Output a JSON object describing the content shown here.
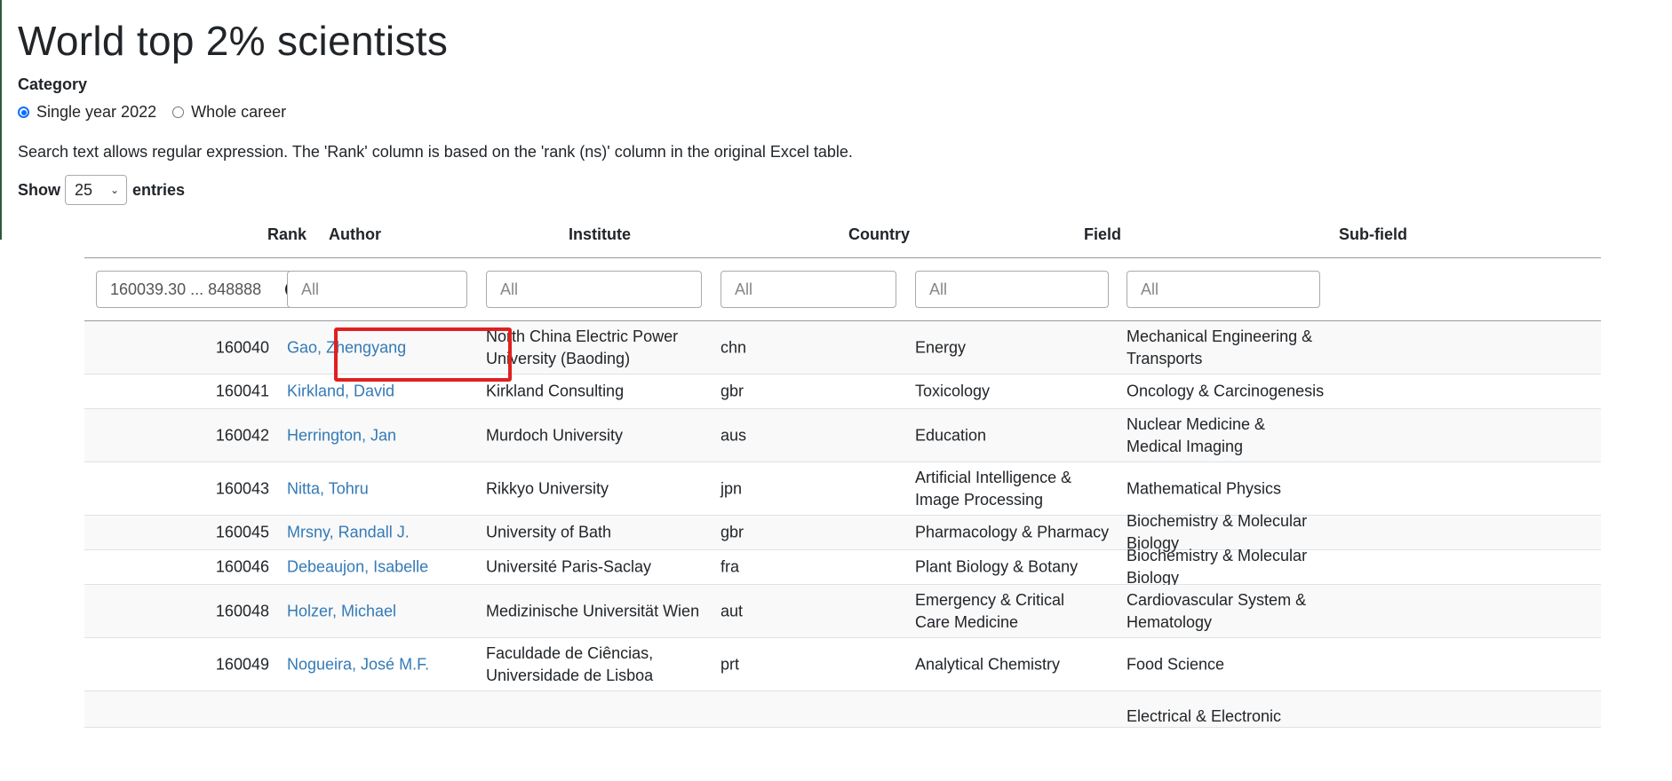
{
  "page": {
    "title": "World top 2% scientists",
    "category_label": "Category",
    "radio_options": [
      {
        "label": "Single year 2022",
        "checked": true
      },
      {
        "label": "Whole career",
        "checked": false
      }
    ],
    "info_text": "Search text allows regular expression. The 'Rank' column is based on the 'rank (ns)' column in the original Excel table.",
    "show_label": "Show",
    "entries_value": "25",
    "entries_label": "entries"
  },
  "table": {
    "headers": {
      "rank": "Rank",
      "author": "Author",
      "institute": "Institute",
      "country": "Country",
      "field": "Field",
      "subfield": "Sub-field"
    },
    "filters": {
      "rank_value": "160039.30 ... 848888",
      "author_placeholder": "All",
      "institute_placeholder": "All",
      "country_placeholder": "All",
      "field_placeholder": "All",
      "subfield_placeholder": "All"
    },
    "rows": [
      {
        "rank": "160040",
        "author": "Gao, Zhengyang",
        "institute": "North China Electric Power University (Baoding)",
        "country": "chn",
        "field": "Energy",
        "subfield": "Mechanical Engineering & Transports"
      },
      {
        "rank": "160041",
        "author": "Kirkland, David",
        "institute": "Kirkland Consulting",
        "country": "gbr",
        "field": "Toxicology",
        "subfield": "Oncology & Carcinogenesis"
      },
      {
        "rank": "160042",
        "author": "Herrington, Jan",
        "institute": "Murdoch University",
        "country": "aus",
        "field": "Education",
        "subfield": "Nuclear Medicine & Medical Imaging"
      },
      {
        "rank": "160043",
        "author": "Nitta, Tohru",
        "institute": "Rikkyo University",
        "country": "jpn",
        "field": "Artificial Intelligence & Image Processing",
        "subfield": "Mathematical Physics"
      },
      {
        "rank": "160045",
        "author": "Mrsny, Randall J.",
        "institute": "University of Bath",
        "country": "gbr",
        "field": "Pharmacology & Pharmacy",
        "subfield": "Biochemistry & Molecular Biology"
      },
      {
        "rank": "160046",
        "author": "Debeaujon, Isabelle",
        "institute": "Université Paris-Saclay",
        "country": "fra",
        "field": "Plant Biology & Botany",
        "subfield": "Biochemistry & Molecular Biology"
      },
      {
        "rank": "160048",
        "author": "Holzer, Michael",
        "institute": "Medizinische Universität Wien",
        "country": "aut",
        "field": "Emergency & Critical Care Medicine",
        "subfield": "Cardiovascular System & Hematology"
      },
      {
        "rank": "160049",
        "author": "Nogueira, José M.F.",
        "institute": "Faculdade de Ciências, Universidade de Lisboa",
        "country": "prt",
        "field": "Analytical Chemistry",
        "subfield": "Food Science"
      },
      {
        "rank": "",
        "author": "",
        "institute": "",
        "country": "",
        "field": "",
        "subfield": "Electrical & Electronic"
      }
    ]
  }
}
